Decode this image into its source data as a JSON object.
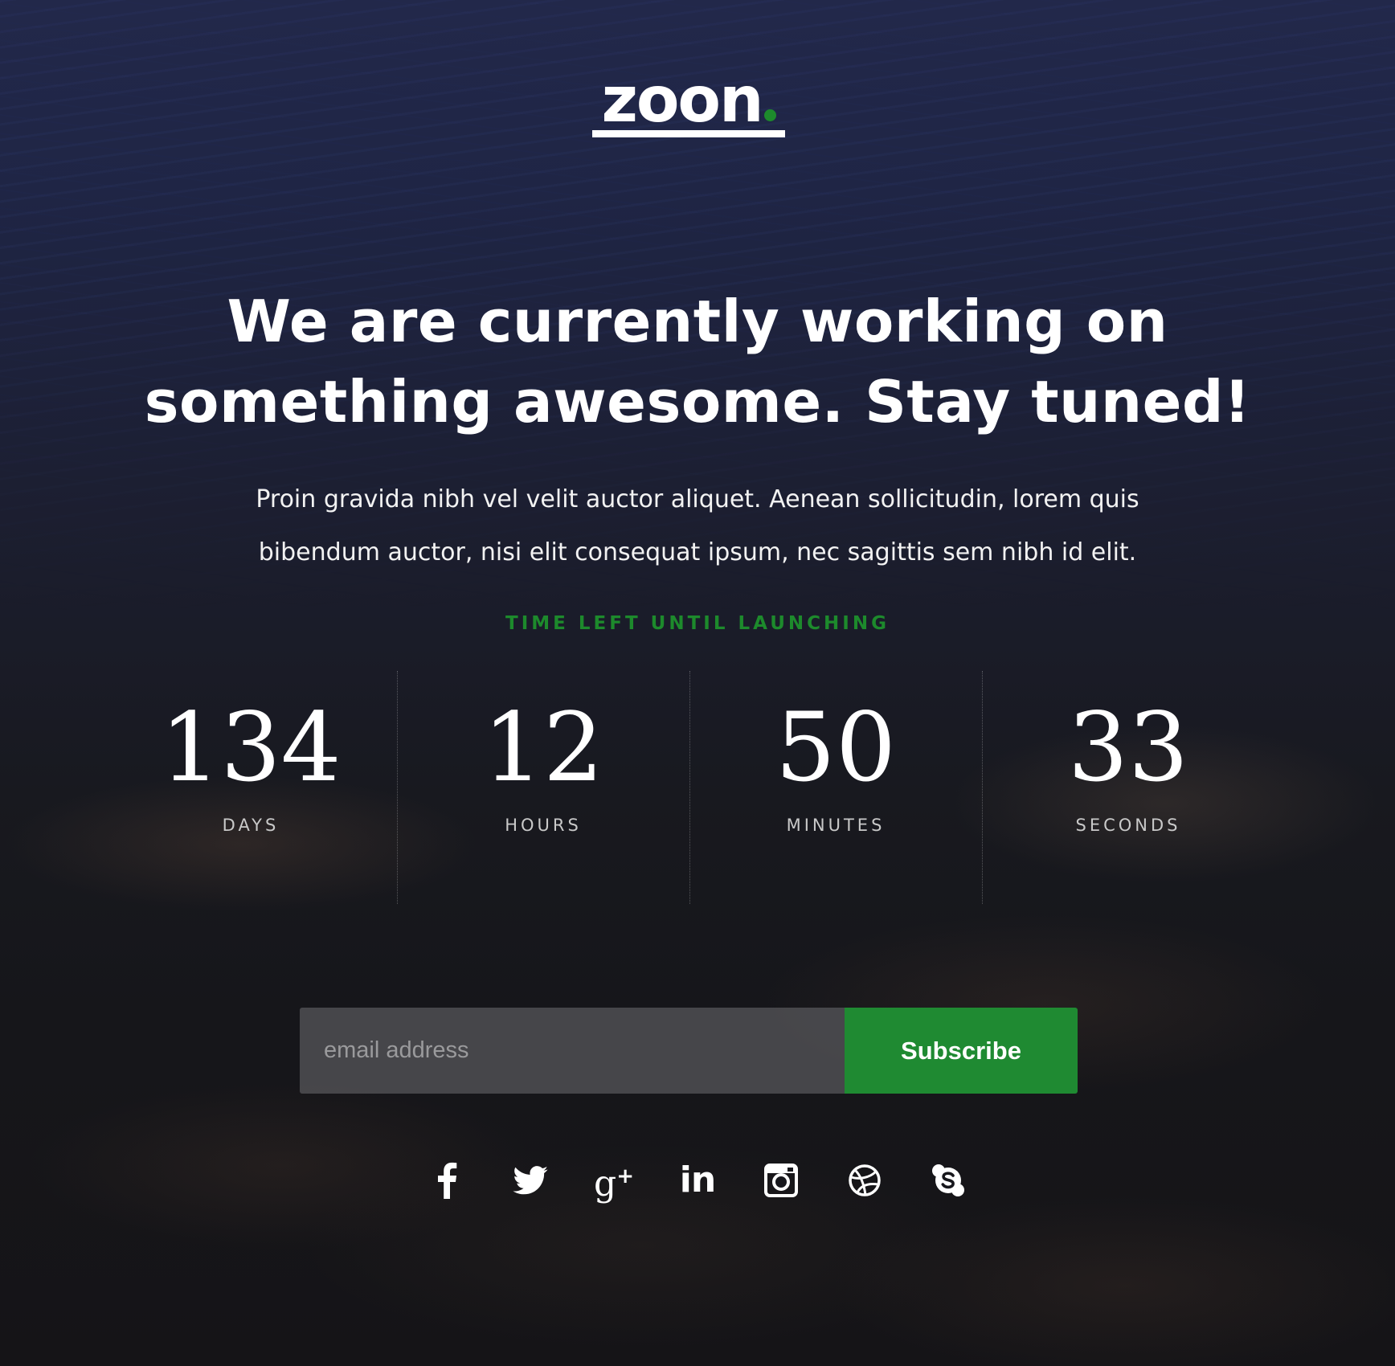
{
  "brand": {
    "name": "zoon",
    "accent_color": "#1d8a2c"
  },
  "hero": {
    "headline_line1": "We are currently working on",
    "headline_line2": "something awesome. Stay tuned!",
    "lead_line1": "Proin gravida nibh vel velit auctor aliquet. Aenean sollicitudin, lorem quis",
    "lead_line2": "bibendum auctor, nisi elit consequat ipsum, nec sagittis sem nibh id elit."
  },
  "countdown": {
    "label": "TIME LEFT UNTIL LAUNCHING",
    "units": [
      {
        "value": "134",
        "name": "DAYS"
      },
      {
        "value": "12",
        "name": "HOURS"
      },
      {
        "value": "50",
        "name": "MINUTES"
      },
      {
        "value": "33",
        "name": "SECONDS"
      }
    ]
  },
  "subscribe": {
    "placeholder": "email address",
    "button_label": "Subscribe",
    "button_color": "#1f8a32"
  },
  "social": {
    "icons": [
      "facebook-icon",
      "twitter-icon",
      "google-plus-icon",
      "linkedin-icon",
      "instagram-icon",
      "dribbble-icon",
      "skype-icon"
    ],
    "gplus_glyph": "g",
    "gplus_sup": "+",
    "linkedin_glyph": "in"
  }
}
